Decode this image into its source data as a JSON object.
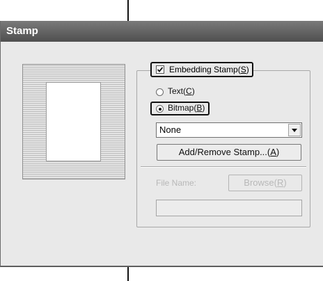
{
  "window": {
    "title": "Stamp"
  },
  "stamp": {
    "embedding_label": "Embedding Stamp",
    "embedding_mnemonic": "S",
    "embedding_checked": true,
    "text_label": "Text",
    "text_mnemonic": "C",
    "bitmap_label": "Bitmap",
    "bitmap_mnemonic": "B",
    "selected_type": "bitmap",
    "dropdown_value": "None",
    "add_remove_label": "Add/Remove Stamp...",
    "add_remove_mnemonic": "A",
    "file_name_label": "File Name:",
    "browse_label": "Browse",
    "browse_mnemonic": "R",
    "file_name_value": ""
  },
  "colors": {
    "titlebar": "#5f5f5f",
    "window_bg": "#e9e9e9",
    "disabled_text": "#b8b8b8",
    "callout": "#111111"
  }
}
